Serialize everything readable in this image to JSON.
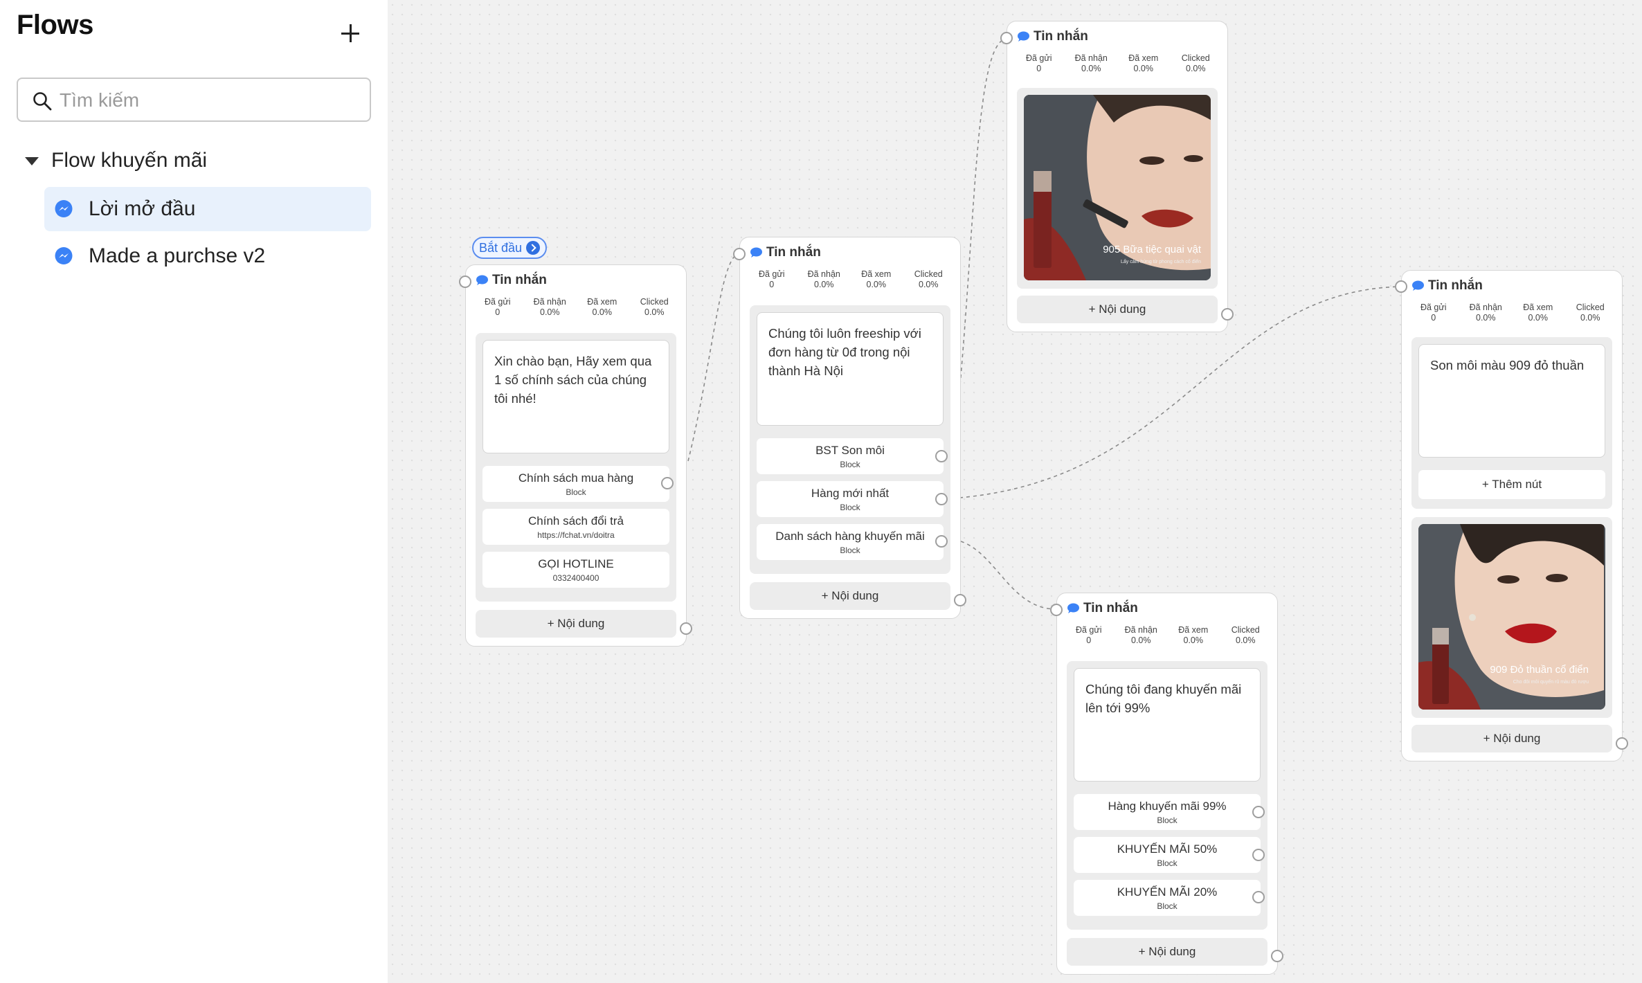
{
  "sidebar": {
    "title": "Flows",
    "search_placeholder": "Tìm kiếm",
    "group": {
      "label": "Flow khuyến mãi"
    },
    "items": [
      {
        "label": "Lời mở đầu",
        "active": true
      },
      {
        "label": "Made a purchse v2",
        "active": false
      }
    ]
  },
  "canvas": {
    "start_badge": "Bắt đầu",
    "stats_labels": [
      "Đã gửi",
      "Đã nhận",
      "Đã xem",
      "Clicked"
    ],
    "nodes": [
      {
        "title": "Tin nhắn",
        "stats": [
          "0",
          "0.0%",
          "0.0%",
          "0.0%"
        ],
        "text": "Xin chào bạn, Hãy xem qua 1 số chính sách của chúng tôi nhé!",
        "buttons": [
          {
            "title": "Chính sách mua hàng",
            "sub": "Block"
          },
          {
            "title": "Chính sách đổi trả",
            "sub": "https://fchat.vn/doitra"
          },
          {
            "title": "GỌI HOTLINE",
            "sub": "0332400400"
          }
        ],
        "add_label": "+ Nội dung"
      },
      {
        "title": "Tin nhắn",
        "stats": [
          "0",
          "0.0%",
          "0.0%",
          "0.0%"
        ],
        "text": "Chúng tôi luôn freeship với đơn hàng từ 0đ trong nội thành Hà Nội",
        "buttons": [
          {
            "title": "BST Son môi",
            "sub": "Block"
          },
          {
            "title": "Hàng mới nhất",
            "sub": "Block"
          },
          {
            "title": "Danh sách hàng khuyến mãi",
            "sub": "Block"
          }
        ],
        "add_label": "+ Nội dung"
      },
      {
        "title": "Tin nhắn",
        "stats": [
          "0",
          "0.0%",
          "0.0%",
          "0.0%"
        ],
        "image_caption": "905 Bữa tiệc quai vật",
        "image_subcaption": "Lấy cảm hứng từ phong cách cổ điển",
        "add_label": "+ Nội dung"
      },
      {
        "title": "Tin nhắn",
        "stats": [
          "0",
          "0.0%",
          "0.0%",
          "0.0%"
        ],
        "text": "Chúng tôi đang khuyến mãi lên tới 99%",
        "buttons": [
          {
            "title": "Hàng khuyến mãi 99%",
            "sub": "Block"
          },
          {
            "title": "KHUYẾN MÃI 50%",
            "sub": "Block"
          },
          {
            "title": "KHUYẾN MÃI 20%",
            "sub": "Block"
          }
        ],
        "add_label": "+ Nội dung"
      },
      {
        "title": "Tin nhắn",
        "stats": [
          "0",
          "0.0%",
          "0.0%",
          "0.0%"
        ],
        "text": "Son môi màu 909 đỏ thuần",
        "add_button_label": "+ Thêm nút",
        "image_caption": "909 Đỏ thuần cổ điển",
        "image_subcaption": "Cho đôi môi quyến rũ màu đỏ rượu",
        "add_label": "+ Nội dung"
      }
    ]
  },
  "colors": {
    "accent": "#2f6fe0",
    "selected_bg": "#e8f1fc",
    "lipstick": "#9e1f22"
  }
}
